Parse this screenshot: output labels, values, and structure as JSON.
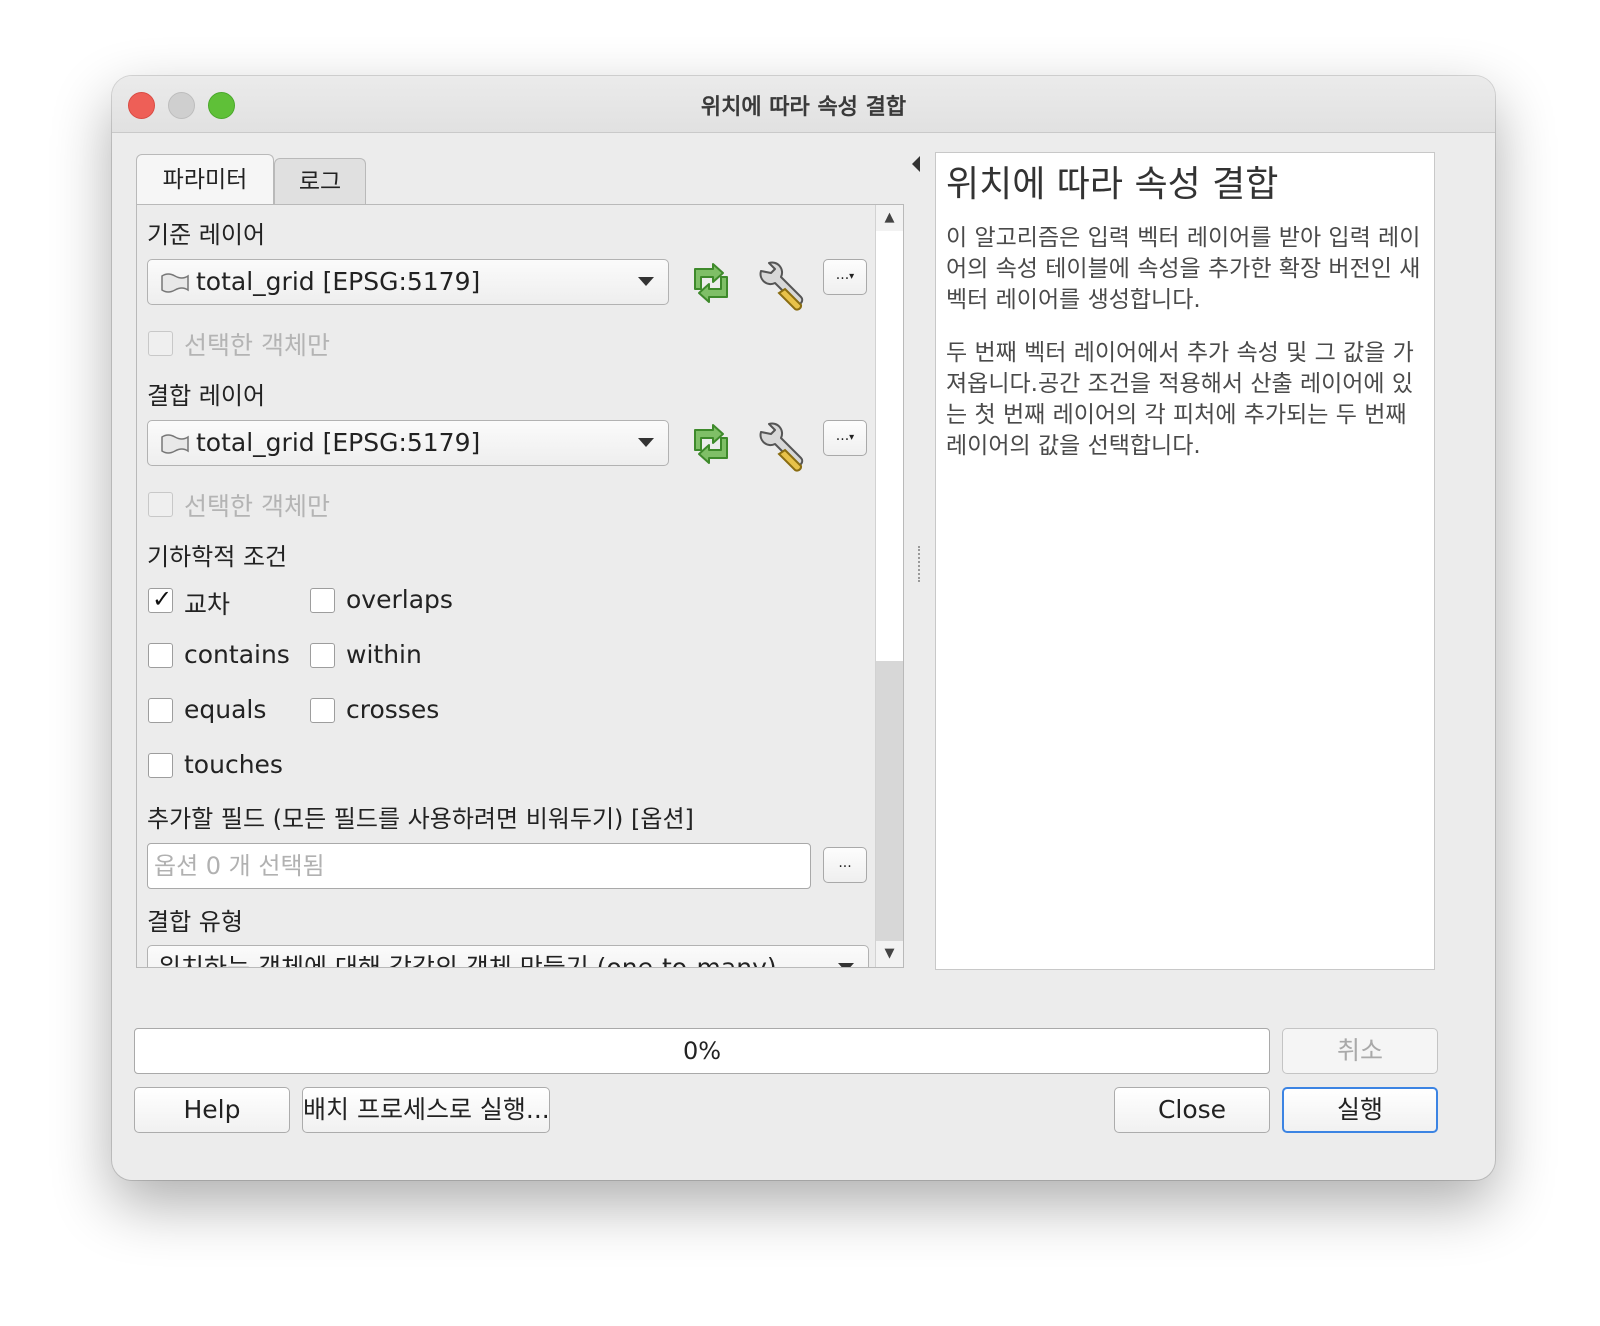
{
  "window": {
    "title": "위치에 따라 속성 결합"
  },
  "tabs": {
    "parameters": "파라미터",
    "log": "로그"
  },
  "params": {
    "input_layer": {
      "label": "기준 레이어",
      "value": "total_grid [EPSG:5179]",
      "selected_only_label": "선택한 객체만",
      "selected_only_checked": false
    },
    "join_layer": {
      "label": "결합 레이어",
      "value": "total_grid [EPSG:5179]",
      "selected_only_label": "선택한 객체만",
      "selected_only_checked": false
    },
    "geometric_predicate": {
      "label": "기하학적 조건",
      "options": [
        {
          "label": "교차",
          "checked": true
        },
        {
          "label": "overlaps",
          "checked": false
        },
        {
          "label": "contains",
          "checked": false
        },
        {
          "label": "within",
          "checked": false
        },
        {
          "label": "equals",
          "checked": false
        },
        {
          "label": "crosses",
          "checked": false
        },
        {
          "label": "touches",
          "checked": false
        }
      ]
    },
    "fields_to_add": {
      "label": "추가할 필드 (모든 필드를 사용하려면 비워두기) [옵션]",
      "placeholder": "옵션 0 개 선택됨",
      "button": "..."
    },
    "join_type": {
      "label": "결합 유형",
      "value": "위치하는 객체에 대해 각각의 객체 만들기 (one-to-many)"
    },
    "more_button": "..."
  },
  "help": {
    "title": "위치에 따라 속성 결합",
    "paragraph1": "이 알고리즘은 입력 벡터 레이어를 받아 입력 레이어의 속성 테이블에 속성을 추가한 확장 버전인 새 벡터 레이어를 생성합니다.",
    "paragraph2": "두 번째 벡터 레이어에서 추가 속성 및 그 값을 가져옵니다.공간 조건을 적용해서 산출 레이어에 있는 첫 번째 레이어의 각 피처에 추가되는 두 번째 레이어의 값을 선택합니다."
  },
  "progress": {
    "text": "0%",
    "value": 0
  },
  "buttons": {
    "cancel": "취소",
    "help": "Help",
    "batch": "배치 프로세스로 실행...",
    "close": "Close",
    "run": "실행"
  }
}
